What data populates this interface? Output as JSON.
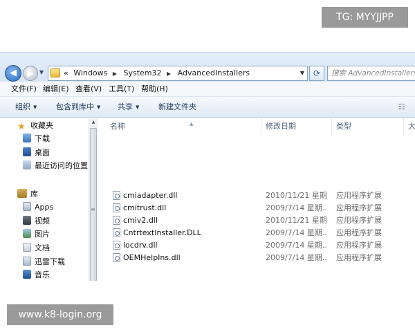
{
  "watermarks": {
    "top": "TG: MYYJJPP",
    "bottom": "www.k8-login.org"
  },
  "address_bar": {
    "prefix": "«",
    "crumbs": [
      "Windows",
      "System32",
      "AdvancedInstallers"
    ],
    "separator": "▶",
    "search_placeholder": "搜索 AdvancedInstallers"
  },
  "menu": [
    "文件(F)",
    "编辑(E)",
    "查看(V)",
    "工具(T)",
    "帮助(H)"
  ],
  "commands": {
    "organize": "组织",
    "include_in_library": "包含到库中",
    "share": "共享",
    "new_folder": "新建文件夹"
  },
  "nav": {
    "favorites_header": "收藏夹",
    "favorites": [
      "下载",
      "桌面",
      "最近访问的位置"
    ],
    "libraries_header": "库",
    "libraries": [
      "Apps",
      "视频",
      "图片",
      "文档",
      "迅雷下载",
      "音乐"
    ]
  },
  "columns": {
    "name": "名称",
    "modified": "修改日期",
    "type": "类型",
    "size": "大"
  },
  "files": [
    {
      "name": "cmiadapter.dll",
      "date": "2010/11/21 星期...",
      "type": "应用程序扩展"
    },
    {
      "name": "cmitrust.dll",
      "date": "2009/7/14 星期...",
      "type": "应用程序扩展"
    },
    {
      "name": "cmiv2.dll",
      "date": "2010/11/21 星期...",
      "type": "应用程序扩展"
    },
    {
      "name": "CntrtextInstaller.DLL",
      "date": "2009/7/14 星期...",
      "type": "应用程序扩展"
    },
    {
      "name": "locdrv.dll",
      "date": "2009/7/14 星期...",
      "type": "应用程序扩展"
    },
    {
      "name": "OEMHelpIns.dll",
      "date": "2009/7/14 星期...",
      "type": "应用程序扩展"
    }
  ],
  "colors": {
    "accent": "#2b6fc4",
    "toolbar_text": "#1e395b",
    "secondary_text": "#6d6d6d"
  }
}
